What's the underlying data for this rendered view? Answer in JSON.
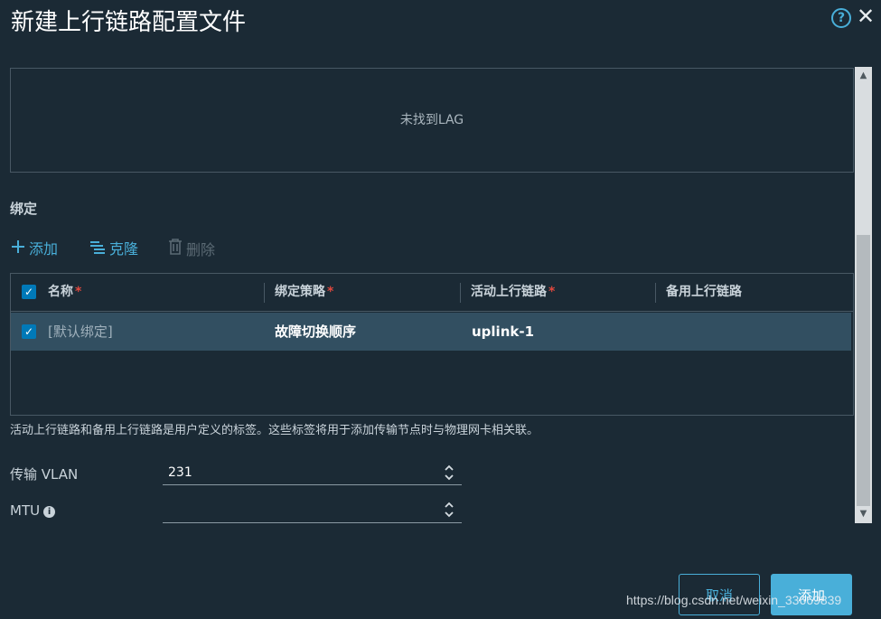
{
  "dialog": {
    "title": "新建上行链路配置文件",
    "help_glyph": "?",
    "close_glyph": "✕"
  },
  "lag": {
    "empty_text": "未找到LAG"
  },
  "bindings": {
    "section_title": "绑定",
    "toolbar": {
      "add_label": "添加",
      "clone_label": "克隆",
      "delete_label": "删除"
    },
    "columns": {
      "name": "名称",
      "policy": "绑定策略",
      "active": "活动上行链路",
      "standby": "备用上行链路",
      "required_mark": "*"
    },
    "rows": [
      {
        "name": "[默认绑定]",
        "policy": "故障切换顺序",
        "active": "uplink-1",
        "standby": ""
      }
    ],
    "note": "活动上行链路和备用上行链路是用户定义的标签。这些标签将用于添加传输节点时与物理网卡相关联。"
  },
  "fields": {
    "transport_vlan": {
      "label": "传输 VLAN",
      "value": "231"
    },
    "mtu": {
      "label": "MTU",
      "value": ""
    }
  },
  "footer": {
    "cancel_label": "取消",
    "add_label": "添加"
  },
  "watermark": "https://blog.csdn.net/weixin_33669839",
  "colors": {
    "background": "#1b2a35",
    "accent": "#49afd9",
    "selected_row": "#324f61",
    "required": "#e0483e"
  }
}
